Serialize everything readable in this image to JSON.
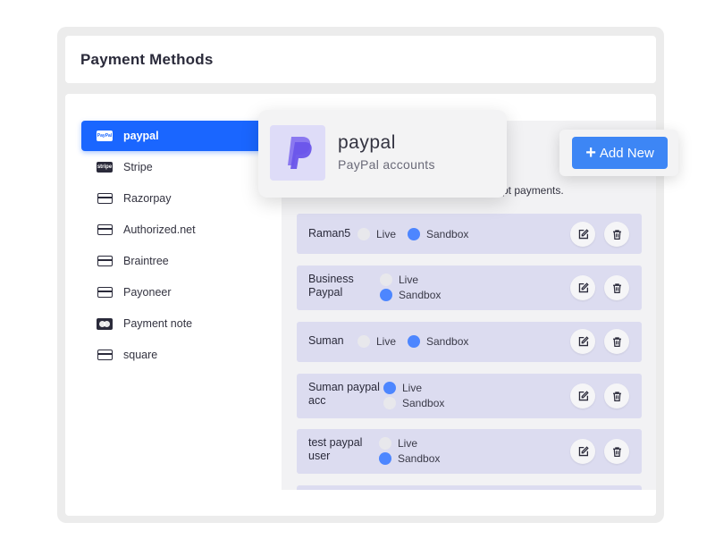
{
  "header": {
    "title": "Payment Methods"
  },
  "sidebar": {
    "items": [
      {
        "label": "paypal",
        "icon": "paypal-logo-icon",
        "active": true
      },
      {
        "label": "Stripe",
        "icon": "stripe-logo-icon"
      },
      {
        "label": "Razorpay",
        "icon": "credit-card-icon"
      },
      {
        "label": "Authorized.net",
        "icon": "credit-card-icon"
      },
      {
        "label": "Braintree",
        "icon": "credit-card-icon"
      },
      {
        "label": "Payoneer",
        "icon": "credit-card-icon"
      },
      {
        "label": "Payment note",
        "icon": "mastercard-icon"
      },
      {
        "label": "square",
        "icon": "credit-card-icon"
      }
    ]
  },
  "gateway_card": {
    "title": "paypal",
    "subtitle": "PayPal accounts",
    "icon": "paypal-p-icon"
  },
  "add_new": {
    "label": "Add New",
    "icon": "plus-icon"
  },
  "main": {
    "description_fragment": "pt payments."
  },
  "accounts": [
    {
      "name": "Raman5",
      "live_label": "Live",
      "sandbox_label": "Sandbox",
      "mode": "sandbox"
    },
    {
      "name": "Business Paypal",
      "live_label": "Live",
      "sandbox_label": "Sandbox",
      "mode": "sandbox"
    },
    {
      "name": "Suman",
      "live_label": "Live",
      "sandbox_label": "Sandbox",
      "mode": "sandbox"
    },
    {
      "name": "Suman paypal acc",
      "live_label": "Live",
      "sandbox_label": "Sandbox",
      "mode": "live"
    },
    {
      "name": "test paypal user",
      "live_label": "Live",
      "sandbox_label": "Sandbox",
      "mode": "sandbox"
    }
  ],
  "colors": {
    "accent": "#1a66ff",
    "button": "#3d86f5",
    "row_bg": "#dcdcf0",
    "radio_on": "#4d86ff"
  }
}
